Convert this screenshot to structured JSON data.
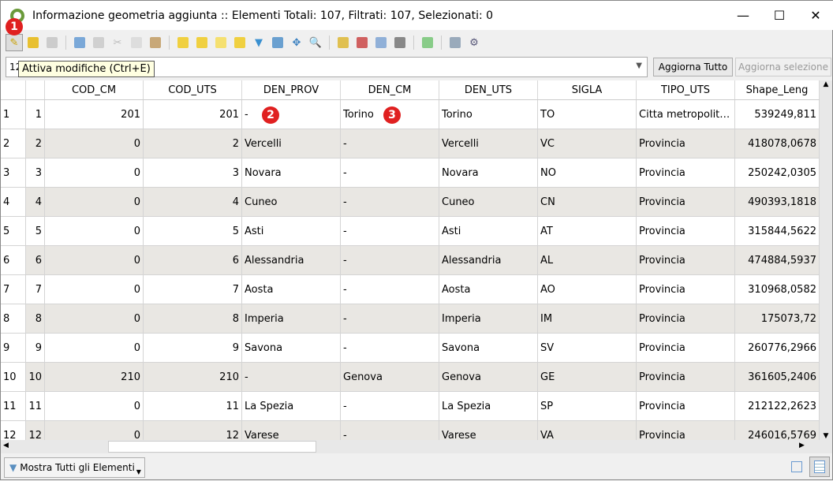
{
  "window": {
    "title": "Informazione geometria aggiunta  :: Elementi Totali: 107, Filtrati: 107, Selezionati: 0",
    "minimize": "—",
    "maximize": "☐",
    "close": "✕"
  },
  "toolbar": {
    "tooltip": "Attiva modifiche (Ctrl+E)"
  },
  "badges": [
    "1",
    "2",
    "3"
  ],
  "filter": {
    "field_prefix": "12",
    "update_all": "Aggiorna Tutto",
    "update_selection": "Aggiorna selezione"
  },
  "columns": [
    "",
    "COD_CM",
    "COD_UTS",
    "DEN_PROV",
    "DEN_CM",
    "DEN_UTS",
    "SIGLA",
    "TIPO_UTS",
    "Shape_Leng"
  ],
  "rows": [
    [
      "1",
      "1",
      "201",
      "201",
      "-",
      "Torino",
      "Torino",
      "TO",
      "Citta metropolit…",
      "539249,811"
    ],
    [
      "2",
      "2",
      "0",
      "2",
      "Vercelli",
      "-",
      "Vercelli",
      "VC",
      "Provincia",
      "418078,0678"
    ],
    [
      "3",
      "3",
      "0",
      "3",
      "Novara",
      "-",
      "Novara",
      "NO",
      "Provincia",
      "250242,0305"
    ],
    [
      "4",
      "4",
      "0",
      "4",
      "Cuneo",
      "-",
      "Cuneo",
      "CN",
      "Provincia",
      "490393,1818"
    ],
    [
      "5",
      "5",
      "0",
      "5",
      "Asti",
      "-",
      "Asti",
      "AT",
      "Provincia",
      "315844,5622"
    ],
    [
      "6",
      "6",
      "0",
      "6",
      "Alessandria",
      "-",
      "Alessandria",
      "AL",
      "Provincia",
      "474884,5937"
    ],
    [
      "7",
      "7",
      "0",
      "7",
      "Aosta",
      "-",
      "Aosta",
      "AO",
      "Provincia",
      "310968,0582"
    ],
    [
      "8",
      "8",
      "0",
      "8",
      "Imperia",
      "-",
      "Imperia",
      "IM",
      "Provincia",
      "175073,72"
    ],
    [
      "9",
      "9",
      "0",
      "9",
      "Savona",
      "-",
      "Savona",
      "SV",
      "Provincia",
      "260776,2966"
    ],
    [
      "10",
      "10",
      "210",
      "210",
      "-",
      "Genova",
      "Genova",
      "GE",
      "Provincia",
      "361605,2406"
    ],
    [
      "11",
      "11",
      "0",
      "11",
      "La Spezia",
      "-",
      "La Spezia",
      "SP",
      "Provincia",
      "212122,2623"
    ],
    [
      "12",
      "12",
      "0",
      "12",
      "Varese",
      "-",
      "Varese",
      "VA",
      "Provincia",
      "246016,5769"
    ]
  ],
  "bottom": {
    "filter_button": "Mostra Tutti gli Elementi"
  }
}
